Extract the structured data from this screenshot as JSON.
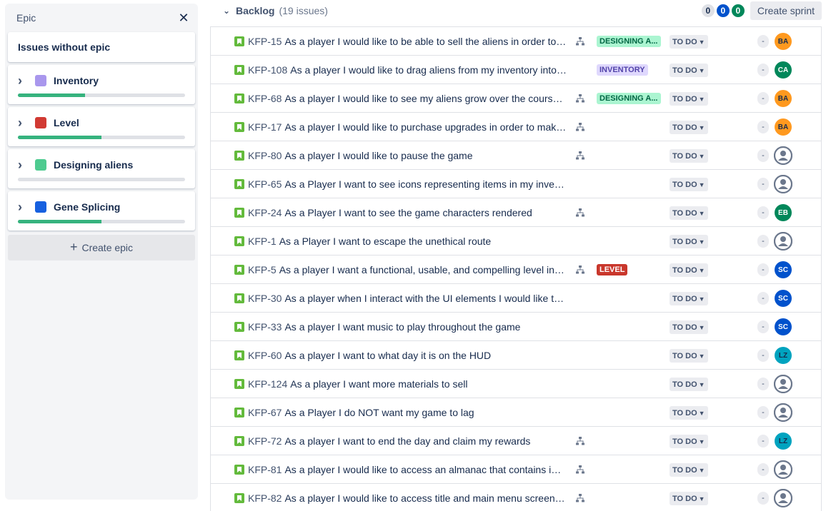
{
  "epic_panel": {
    "title": "Epic",
    "close_icon": "close-icon",
    "issues_without_epic": "Issues without epic",
    "epics": [
      {
        "name": "Inventory",
        "color": "#a997ed",
        "progress": 0.4
      },
      {
        "name": "Level",
        "color": "#d13a33",
        "progress": 0.5
      },
      {
        "name": "Designing aliens",
        "color": "#4ecb90",
        "progress": 0
      },
      {
        "name": "Gene Splicing",
        "color": "#1760df",
        "progress": 0.5
      }
    ],
    "create_epic_label": "Create epic"
  },
  "backlog": {
    "title": "Backlog",
    "count": "(19 issues)",
    "counters": {
      "todo": "0",
      "in_progress": "0",
      "done": "0"
    },
    "create_sprint_label": "Create sprint"
  },
  "colors": {
    "story_icon": "#63ba3c",
    "epic_designing_bg": "#abf5d1",
    "epic_designing_fg": "#006644",
    "epic_inventory_bg": "#dfd8fd",
    "epic_inventory_fg": "#5243aa",
    "epic_level_bg": "#c9372c",
    "epic_level_fg": "#ffffff",
    "avatar_orange": "#ff991f",
    "avatar_green": "#00875a",
    "avatar_blue": "#0052cc",
    "avatar_teal": "#00a3bf"
  },
  "issues": [
    {
      "key": "KFP-15",
      "summary": "As a player I would like to be able to sell the aliens in order to ...",
      "has_child": true,
      "epic": "DESIGNING A...",
      "epic_kind": "designing",
      "status": "TO DO",
      "estimate": "-",
      "avatar": "BA",
      "avatar_kind": "orange"
    },
    {
      "key": "KFP-108",
      "summary": "As a player I would like to drag aliens from my inventory into the ...",
      "has_child": false,
      "epic": "INVENTORY",
      "epic_kind": "inventory",
      "status": "TO DO",
      "estimate": "-",
      "avatar": "CA",
      "avatar_kind": "green"
    },
    {
      "key": "KFP-68",
      "summary": "As a player I would like to see my aliens grow over the course ...",
      "has_child": true,
      "epic": "DESIGNING A...",
      "epic_kind": "designing",
      "status": "TO DO",
      "estimate": "-",
      "avatar": "BA",
      "avatar_kind": "orange"
    },
    {
      "key": "KFP-17",
      "summary": "As a player I would like to purchase upgrades in order to make ...",
      "has_child": true,
      "epic": "",
      "epic_kind": "",
      "status": "TO DO",
      "estimate": "-",
      "avatar": "BA",
      "avatar_kind": "orange"
    },
    {
      "key": "KFP-80",
      "summary": "As a player I would like to pause the game",
      "has_child": true,
      "epic": "",
      "epic_kind": "",
      "status": "TO DO",
      "estimate": "-",
      "avatar": "",
      "avatar_kind": "generic"
    },
    {
      "key": "KFP-65",
      "summary": "As a Player I want to see icons representing items in my inventory",
      "has_child": false,
      "epic": "",
      "epic_kind": "",
      "status": "TO DO",
      "estimate": "-",
      "avatar": "",
      "avatar_kind": "generic"
    },
    {
      "key": "KFP-24",
      "summary": "As a Player I want to see the game characters rendered",
      "has_child": true,
      "epic": "",
      "epic_kind": "",
      "status": "TO DO",
      "estimate": "-",
      "avatar": "EB",
      "avatar_kind": "green"
    },
    {
      "key": "KFP-1",
      "summary": "As a Player I want to escape the unethical route",
      "has_child": false,
      "epic": "",
      "epic_kind": "",
      "status": "TO DO",
      "estimate": "-",
      "avatar": "",
      "avatar_kind": "generic"
    },
    {
      "key": "KFP-5",
      "summary": "As a player I want a functional, usable, and compelling level in t...",
      "has_child": true,
      "epic": "LEVEL",
      "epic_kind": "level",
      "status": "TO DO",
      "estimate": "-",
      "avatar": "SC",
      "avatar_kind": "blue"
    },
    {
      "key": "KFP-30",
      "summary": "As a player when I interact with the UI elements I would like there t...",
      "has_child": false,
      "epic": "",
      "epic_kind": "",
      "status": "TO DO",
      "estimate": "-",
      "avatar": "SC",
      "avatar_kind": "blue"
    },
    {
      "key": "KFP-33",
      "summary": "As a player I want music to play throughout the game",
      "has_child": false,
      "epic": "",
      "epic_kind": "",
      "status": "TO DO",
      "estimate": "-",
      "avatar": "SC",
      "avatar_kind": "blue"
    },
    {
      "key": "KFP-60",
      "summary": "As a player I want to what day it is on the HUD",
      "has_child": false,
      "epic": "",
      "epic_kind": "",
      "status": "TO DO",
      "estimate": "-",
      "avatar": "LZ",
      "avatar_kind": "teal"
    },
    {
      "key": "KFP-124",
      "summary": "As a player I want more materials to sell",
      "has_child": false,
      "epic": "",
      "epic_kind": "",
      "status": "TO DO",
      "estimate": "-",
      "avatar": "",
      "avatar_kind": "generic"
    },
    {
      "key": "KFP-67",
      "summary": "As a Player I do NOT want my game to lag",
      "has_child": false,
      "epic": "",
      "epic_kind": "",
      "status": "TO DO",
      "estimate": "-",
      "avatar": "",
      "avatar_kind": "generic"
    },
    {
      "key": "KFP-72",
      "summary": "As a player I want to end the day and claim my rewards",
      "has_child": true,
      "epic": "",
      "epic_kind": "",
      "status": "TO DO",
      "estimate": "-",
      "avatar": "LZ",
      "avatar_kind": "teal"
    },
    {
      "key": "KFP-81",
      "summary": "As a player I would like to access an almanac that contains infor...",
      "has_child": true,
      "epic": "",
      "epic_kind": "",
      "status": "TO DO",
      "estimate": "-",
      "avatar": "",
      "avatar_kind": "generic"
    },
    {
      "key": "KFP-82",
      "summary": "As a player I would like to access title and main menu screen to...",
      "has_child": true,
      "epic": "",
      "epic_kind": "",
      "status": "TO DO",
      "estimate": "-",
      "avatar": "",
      "avatar_kind": "generic"
    }
  ]
}
